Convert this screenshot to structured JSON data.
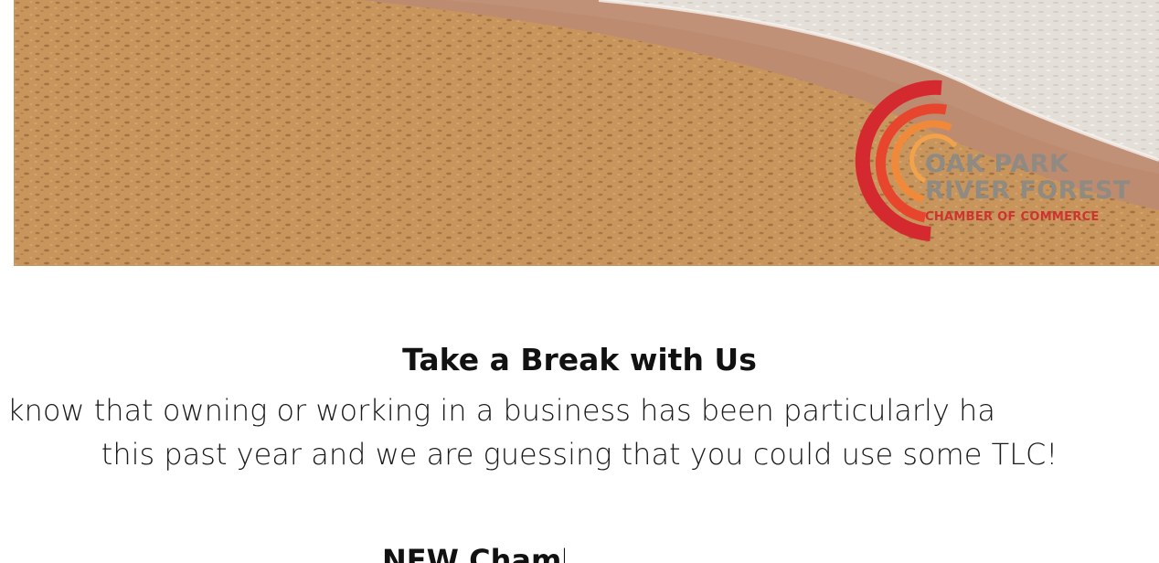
{
  "hero": {
    "logo": {
      "line1": "OAK PARK",
      "line2": "RIVER FOREST",
      "line3": "CHAMBER OF COMMERCE",
      "colors": {
        "outer_arc": "#d42a2f",
        "middle_arc": "#e8452e",
        "inner_arc": "#f08a3a"
      }
    },
    "colors": {
      "sand": "#c9955c",
      "wet_sand": "#bd8a6f",
      "foam": "#e6e2dc"
    }
  },
  "content": {
    "heading": "Take a Break with Us",
    "paragraph_line1": "know that owning or working in a business has been particularly ha",
    "paragraph_line2": "this past year and we are guessing that you could use some TLC!",
    "partial_bold": "NEW Chamb"
  }
}
